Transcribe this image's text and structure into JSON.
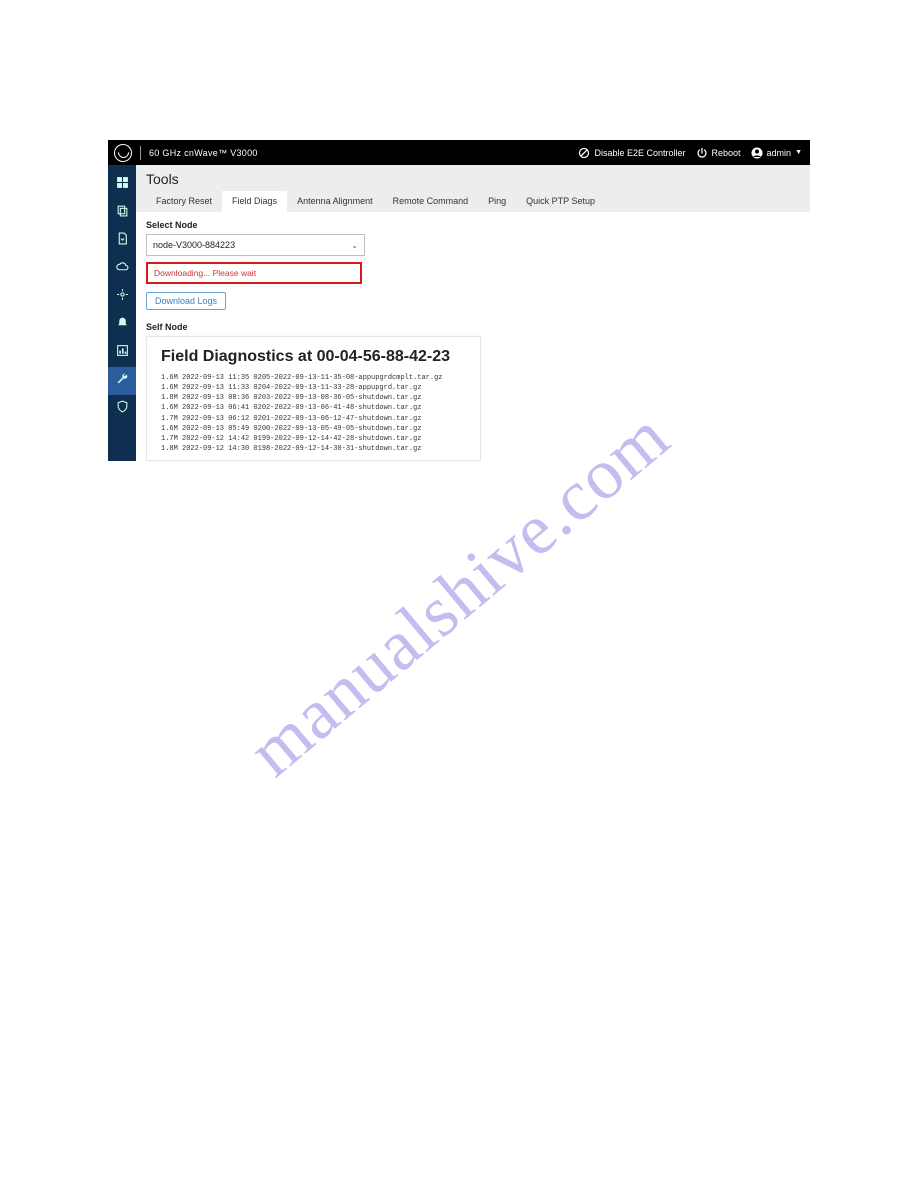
{
  "watermark": "manualshive.com",
  "topbar": {
    "brand": "60 GHz cnWave™ V3000",
    "disable": "Disable E2E Controller",
    "reboot": "Reboot",
    "user": "admin"
  },
  "page": {
    "title": "Tools",
    "tabs": [
      "Factory Reset",
      "Field Diags",
      "Antenna Alignment",
      "Remote Command",
      "Ping",
      "Quick PTP Setup"
    ],
    "active_tab": 1
  },
  "select": {
    "label": "Select Node",
    "value": "node-V3000-884223"
  },
  "status": "Downloading... Please wait",
  "download_btn": "Download Logs",
  "self_node_label": "Self Node",
  "diag": {
    "title_prefix": "Field Diagnostics at ",
    "mac": "00-04-56-88-42-23",
    "lines": [
      "1.6M 2022-09-13 11:35 0205-2022-09-13-11-35-08-appupgrdcmplt.tar.gz",
      "1.6M 2022-09-13 11:33 0204-2022-09-13-11-33-28-appupgrd.tar.gz",
      "1.8M 2022-09-13 08:36 0203-2022-09-13-08-36-05-shutdown.tar.gz",
      "1.6M 2022-09-13 06:41 0202-2022-09-13-06-41-48-shutdown.tar.gz",
      "1.7M 2022-09-13 06:12 0201-2022-09-13-06-12-47-shutdown.tar.gz",
      "1.6M 2022-09-13 05:49 0200-2022-09-13-05-49-05-shutdown.tar.gz",
      "1.7M 2022-09-12 14:42 0199-2022-09-12-14-42-28-shutdown.tar.gz",
      "1.8M 2022-09-12 14:30 0198-2022-09-12-14-30-31-shutdown.tar.gz"
    ]
  }
}
